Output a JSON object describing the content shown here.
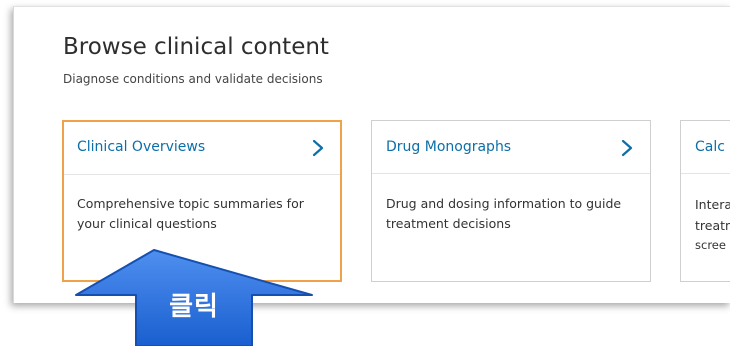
{
  "browse": {
    "title": "Browse clinical content",
    "subtitle": "Diagnose conditions and validate decisions"
  },
  "cards": [
    {
      "title": "Clinical Overviews",
      "description": "Comprehensive topic summaries for your clinical questions",
      "state": "selected",
      "chevron_icon": "chevron-right-icon"
    },
    {
      "title": "Drug Monographs",
      "description": "Drug and dosing information to guide treatment decisions",
      "chevron_icon": "chevron-right-icon"
    },
    {
      "title": "Calc",
      "description_lines": [
        "Intera",
        "treatn",
        "scree"
      ]
    }
  ],
  "annotation": {
    "label": "클릭",
    "icon": "arrow-up-icon"
  },
  "colors": {
    "link": "#0c6fa8",
    "selected_border": "#f0a24a",
    "annotation_fill": "#1f6de0",
    "annotation_edge": "#1550b0"
  }
}
